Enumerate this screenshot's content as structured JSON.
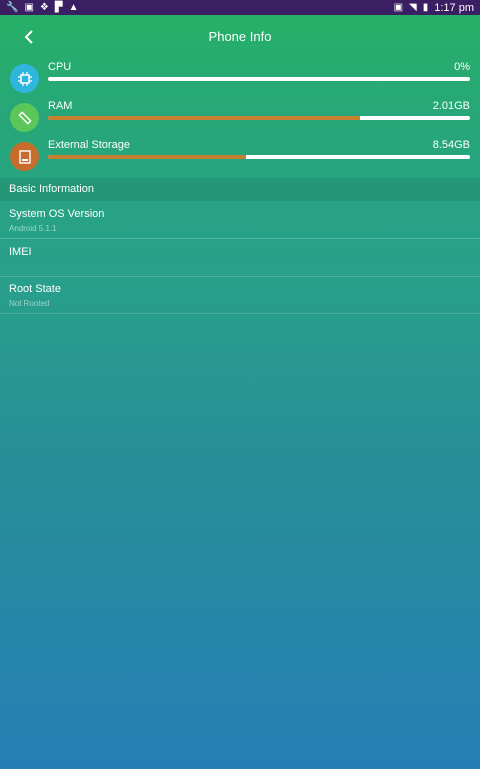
{
  "status_bar": {
    "time": "1:17 pm"
  },
  "header": {
    "title": "Phone Info"
  },
  "meters": [
    {
      "label": "CPU",
      "value": "0%",
      "fill": 0,
      "icon": "cpu-chip-icon",
      "icon_color": "#2fb6df"
    },
    {
      "label": "RAM",
      "value": "2.01GB",
      "fill": 0.74,
      "icon": "ram-stick-icon",
      "icon_color": "#5bc65a"
    },
    {
      "label": "External Storage",
      "value": "8.54GB",
      "fill": 0.47,
      "icon": "storage-drive-icon",
      "icon_color": "#c66d2e"
    }
  ],
  "basic_info": {
    "heading": "Basic Information",
    "rows": [
      {
        "title": "System OS Version",
        "subtitle": "Android 5.1.1"
      },
      {
        "title": "IMEI",
        "subtitle": ""
      },
      {
        "title": "Root State",
        "subtitle": "Not Rooted"
      }
    ]
  },
  "colors": {
    "bar_fill": "#c68130",
    "bar_track": "#ffffff",
    "status_bar_bg": "#3a1f63"
  }
}
